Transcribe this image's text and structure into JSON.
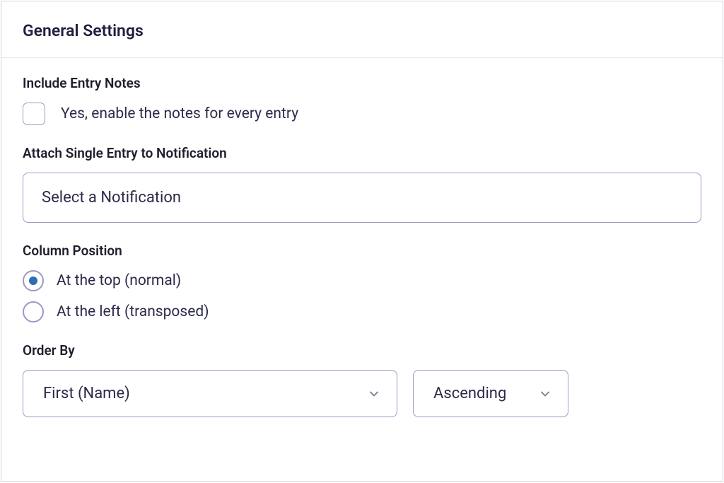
{
  "panel": {
    "title": "General Settings"
  },
  "includeEntryNotes": {
    "label": "Include Entry Notes",
    "checkboxLabel": "Yes, enable the notes for every entry",
    "checked": false
  },
  "attachNotification": {
    "label": "Attach Single Entry to Notification",
    "selected": "Select a Notification"
  },
  "columnPosition": {
    "label": "Column Position",
    "options": [
      {
        "label": "At the top (normal)",
        "checked": true
      },
      {
        "label": "At the left (transposed)",
        "checked": false
      }
    ]
  },
  "orderBy": {
    "label": "Order By",
    "field": "First (Name)",
    "direction": "Ascending"
  }
}
